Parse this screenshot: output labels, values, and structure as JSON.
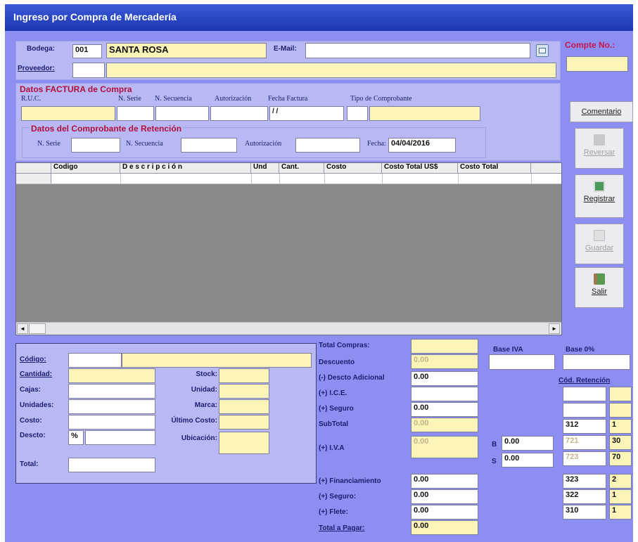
{
  "window": {
    "title": "Ingreso por Compra de Mercadería"
  },
  "header": {
    "bodega_label": "Bodega:",
    "bodega_code": "001",
    "bodega_name": "SANTA ROSA",
    "email_label": "E-Mail:",
    "email_value": "",
    "proveedor_label": "Proveedor:",
    "compte_label": "Compte No.:"
  },
  "factura": {
    "section_title": "Datos FACTURA de Compra",
    "ruc_label": "R.U.C.",
    "serie_label": "N. Serie",
    "secuencia_label": "N. Secuencia",
    "autorizacion_label": "Autorización",
    "fecha_label": "Fecha Factura",
    "fecha_value": "/ /",
    "tipo_label": "Tipo de Comprobante"
  },
  "retencion": {
    "section_title": "Datos del Comprobante de Retención",
    "serie_label": "N. Serie",
    "secuencia_label": "N. Secuencia",
    "autorizacion_label": "Autorización",
    "fecha_label": "Fecha:",
    "fecha_value": "04/04/2016"
  },
  "grid": {
    "columns": [
      "Codigo",
      "D e s c r i p c i ó n",
      "Und",
      "Cant.",
      "Costo",
      "Costo Total US$",
      "Costo Total"
    ]
  },
  "scroll": {
    "left": "◄",
    "right": "►"
  },
  "actions": {
    "comentario": "Comentario",
    "reversar": "Reversar",
    "registrar": "Registrar",
    "guardar": "Guardar",
    "salir": "Salir"
  },
  "item": {
    "codigo_label": "Código:",
    "cantidad_label": "Cantidad:",
    "cajas_label": "Cajas:",
    "unidades_label": "Unidades:",
    "costo_label": "Costo:",
    "descto_label": "Descto:",
    "descto_symbol": "%",
    "total_label": "Total:",
    "stock_label": "Stock:",
    "unidad_label": "Unidad:",
    "marca_label": "Marca:",
    "ultimo_costo_label": "Último Costo:",
    "ubicacion_label": "Ubicación:"
  },
  "totals": {
    "total_compras_label": "Total Compras:",
    "descuento_label": "Descuento",
    "descuento_value": "0.00",
    "descto_adicional_label": "(-) Descto Adicional",
    "descto_adicional_value": "0.00",
    "ice_label": "(+) I.C.E.",
    "seguro_label": "(+) Seguro",
    "seguro_value": "0.00",
    "subtotal_label": "SubTotal",
    "subtotal_value": "0.00",
    "iva_label": "(+) I.V.A",
    "iva_value": "0.00",
    "financiamiento_label": "(+) Financiamiento",
    "financiamiento_value": "0.00",
    "seguro2_label": "(+) Seguro:",
    "seguro2_value": "0.00",
    "flete_label": "(+) Flete:",
    "flete_value": "0.00",
    "total_pagar_label": "Total a Pagar:",
    "total_pagar_value": "0.00"
  },
  "bases": {
    "base_iva_label": "Base IVA",
    "base_0_label": "Base 0%",
    "cod_retencion_label": "Cód. Retención",
    "b_label": "B",
    "b_value": "0.00",
    "s_label": "S",
    "s_value": "0.00"
  },
  "retention_rows": [
    {
      "code": "",
      "pct": ""
    },
    {
      "code": "",
      "pct": ""
    },
    {
      "code": "312",
      "pct": "1"
    },
    {
      "code": "721",
      "pct": "30"
    },
    {
      "code": "723",
      "pct": "70"
    },
    {
      "code": "323",
      "pct": "2"
    },
    {
      "code": "322",
      "pct": "1"
    },
    {
      "code": "310",
      "pct": "1"
    }
  ],
  "colors": {
    "form_bg": "#8c8ef2",
    "panel_bg": "#b8b8f4",
    "titlebar": "#2444c8",
    "grid_bg": "#8a8a8a",
    "label_text": "#1b1e6e",
    "section_red": "#b0103a",
    "field_yellow": "#fbf4b8"
  }
}
